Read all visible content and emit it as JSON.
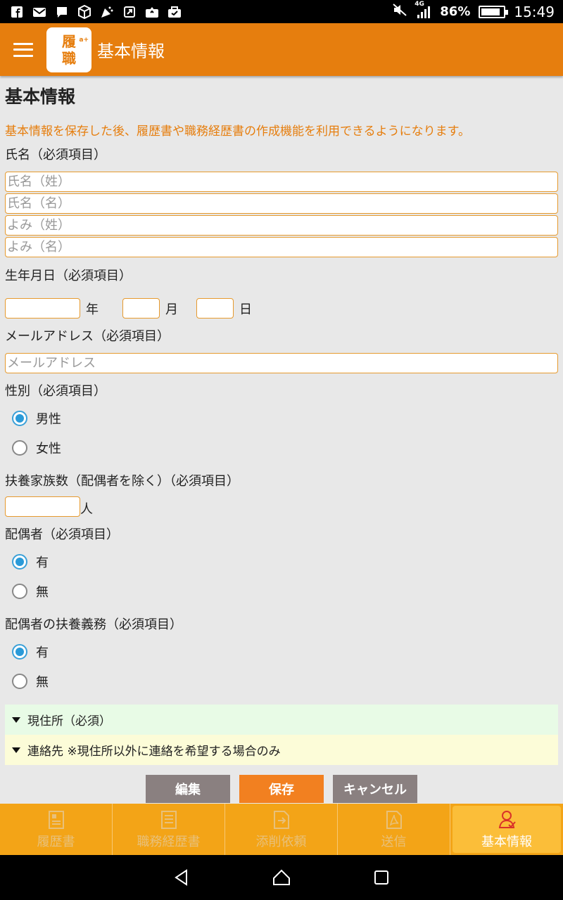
{
  "status_bar": {
    "network": "4G",
    "battery_percent": "86%",
    "battery_level": 0.86,
    "time": "15:49",
    "icons": [
      "facebook-icon",
      "mail-icon",
      "chat-icon",
      "cube-icon",
      "party-icon",
      "share-icon",
      "upload-icon",
      "briefcase-icon"
    ]
  },
  "app_bar": {
    "logo_top": "履",
    "logo_bottom": "職",
    "logo_badge": "a+",
    "title": "基本情報"
  },
  "form": {
    "heading": "基本情報",
    "intro": "基本情報を保存した後、履歴書や職務経歴書の作成機能を利用できるようになります。",
    "name_label": "氏名（必須項目）",
    "name_fields": {
      "last_name_placeholder": "氏名（姓）",
      "first_name_placeholder": "氏名（名）",
      "last_kana_placeholder": "よみ（姓）",
      "first_kana_placeholder": "よみ（名）"
    },
    "birth_label": "生年月日（必須項目）",
    "birth_units": {
      "year": "年",
      "month": "月",
      "day": "日"
    },
    "email_label": "メールアドレス（必須項目）",
    "email_placeholder": "メールアドレス",
    "gender_label": "性別（必須項目）",
    "gender_options": {
      "male": "男性",
      "female": "女性",
      "selected": "男性"
    },
    "dependents_label": "扶養家族数（配偶者を除く）（必須項目）",
    "dependents_unit": "人",
    "spouse_label": "配偶者（必須項目）",
    "spouse_options": {
      "yes": "有",
      "no": "無",
      "selected": "有"
    },
    "spouse_support_label": "配偶者の扶養義務（必須項目）",
    "spouse_support_options": {
      "yes": "有",
      "no": "無",
      "selected": "有"
    },
    "accordion_address": "現住所（必須）",
    "accordion_contact": "連絡先 ※現住所以外に連絡を希望する場合のみ",
    "buttons": {
      "edit": "編集",
      "save": "保存",
      "cancel": "キャンセル"
    }
  },
  "bottom_nav": {
    "items": [
      {
        "label": "履歴書",
        "icon": "resume-icon"
      },
      {
        "label": "職務経歴書",
        "icon": "document-icon"
      },
      {
        "label": "添削依頼",
        "icon": "file-arrow-icon"
      },
      {
        "label": "送信",
        "icon": "pdf-icon"
      },
      {
        "label": "基本情報",
        "icon": "user-icon"
      }
    ],
    "active": "基本情報"
  }
}
